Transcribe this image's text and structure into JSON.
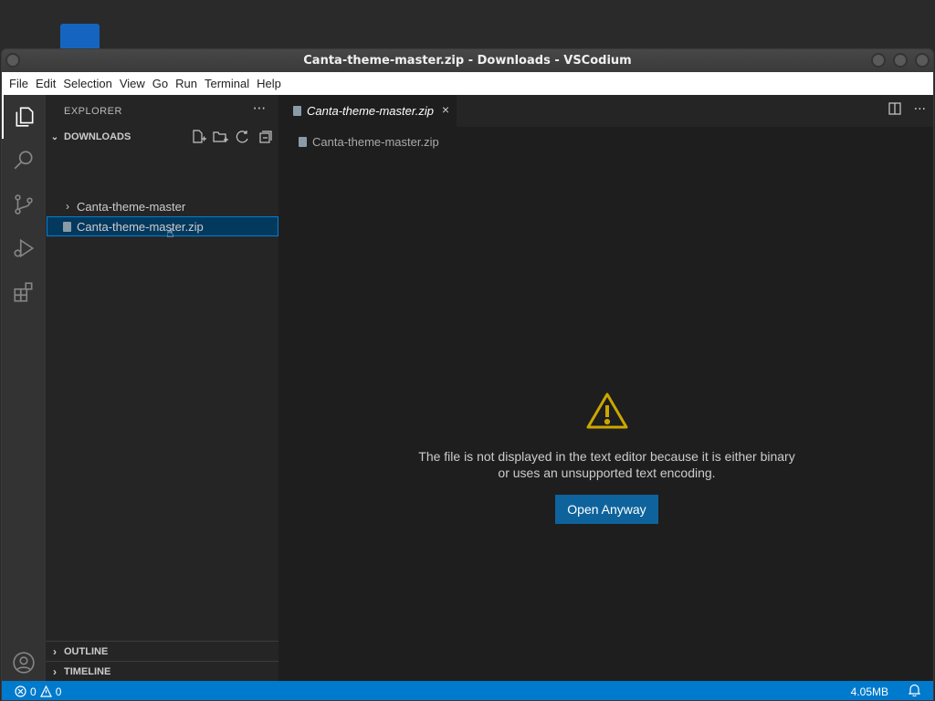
{
  "window": {
    "title": "Canta-theme-master.zip - Downloads - VSCodium"
  },
  "menu": [
    "File",
    "Edit",
    "Selection",
    "View",
    "Go",
    "Run",
    "Terminal",
    "Help"
  ],
  "sidebar": {
    "title": "EXPLORER",
    "more": "···",
    "section": "DOWNLOADS",
    "items": [
      {
        "label": "Canta-theme-master",
        "type": "folder"
      },
      {
        "label": "Canta-theme-master.zip",
        "type": "file",
        "selected": true
      }
    ],
    "outline": "OUTLINE",
    "timeline": "TIMELINE"
  },
  "editor": {
    "tab_label": "Canta-theme-master.zip",
    "tab_close": "×",
    "breadcrumb": "Canta-theme-master.zip",
    "message_line1": "The file is not displayed in the text editor because it is either binary",
    "message_line2": "or uses an unsupported text encoding.",
    "open_button": "Open Anyway"
  },
  "status": {
    "errors": "0",
    "warnings": "0",
    "file_size": "4.05MB"
  },
  "colors": {
    "accent": "#007acc",
    "button": "#0e639c",
    "warning": "#cca700"
  }
}
